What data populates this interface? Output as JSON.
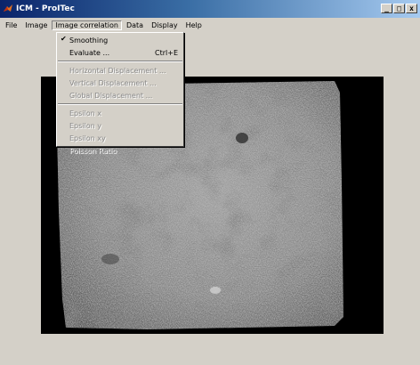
{
  "window": {
    "title": "ICM - ProITec",
    "buttons": {
      "minimize": "_",
      "maximize": "□",
      "close": "x"
    }
  },
  "menubar": {
    "items": [
      {
        "label": "File"
      },
      {
        "label": "Image"
      },
      {
        "label": "Image correlation",
        "active": true
      },
      {
        "label": "Data"
      },
      {
        "label": "Display"
      },
      {
        "label": "Help"
      }
    ]
  },
  "dropdown": {
    "smoothing": {
      "label": "Smoothing",
      "checked": true
    },
    "evaluate": {
      "label": "Evaluate ...",
      "shortcut": "Ctrl+E"
    },
    "horizontal_displacement": "Horizontal Displacement ...",
    "vertical_displacement": "Vertical Displacement ...",
    "global_displacement": "Global Displacement ...",
    "epsilon_x": "Epsilon x",
    "epsilon_y": "Epsilon y",
    "epsilon_xy": "Epsilon xy",
    "poisson_ratio": "Poisson Ratio"
  },
  "icons": {
    "app": "matlab-logo-icon",
    "check": "checkmark-icon"
  },
  "colors": {
    "titlebar_start": "#0a246a",
    "titlebar_end": "#a6caf0",
    "chrome": "#d4d0c8",
    "disabled_text": "#8a8a8a"
  }
}
